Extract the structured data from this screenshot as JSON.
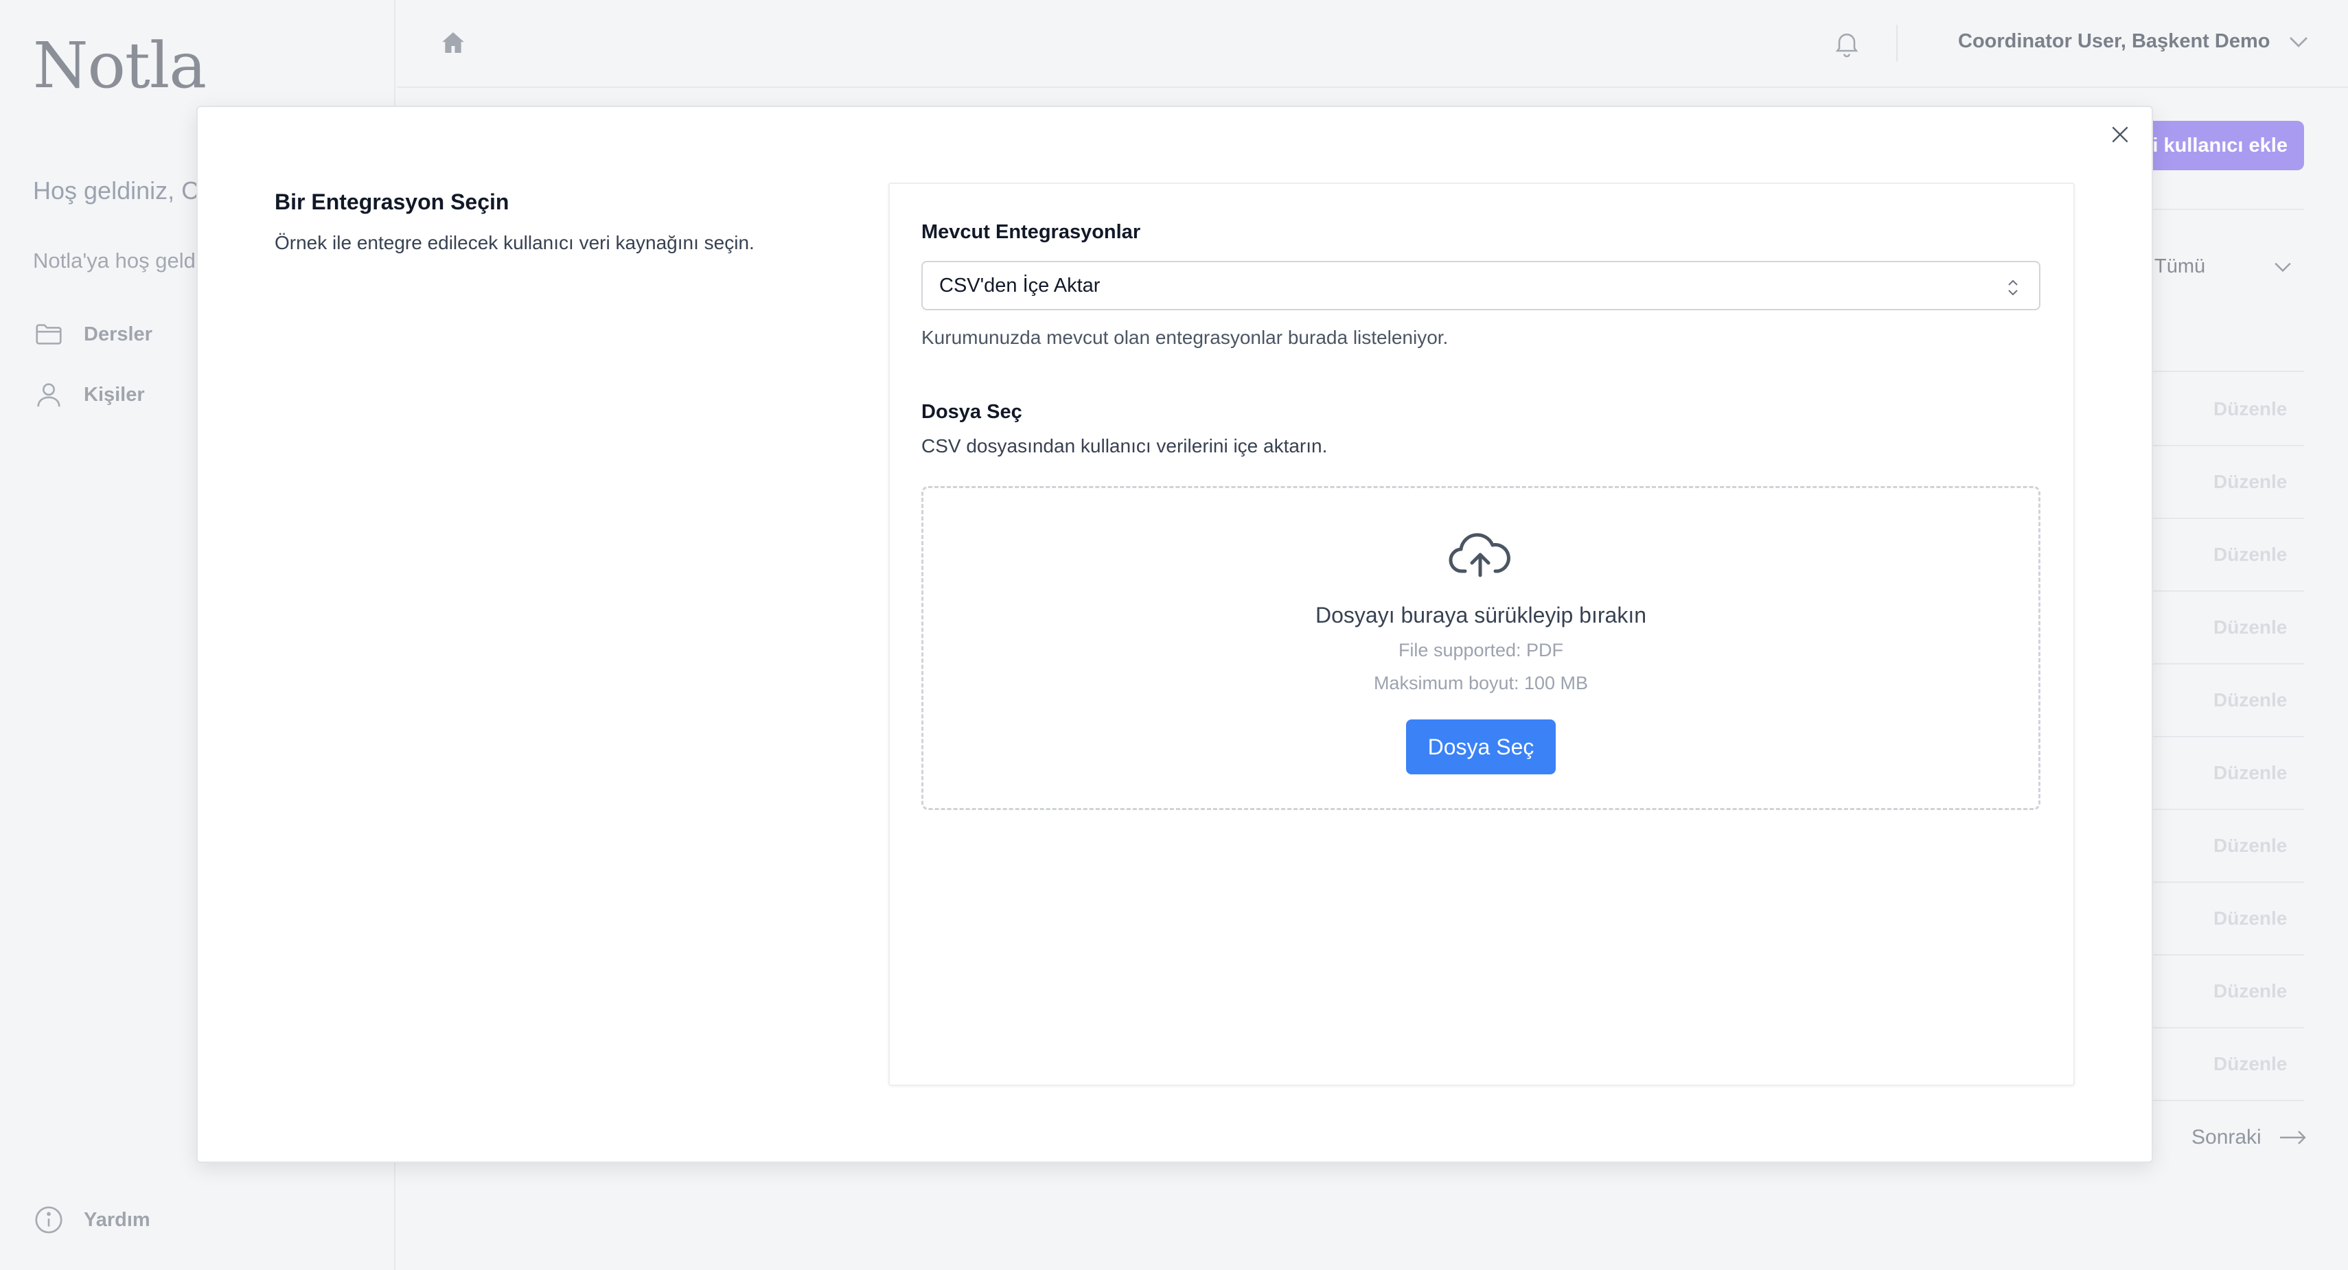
{
  "app": {
    "logo": "Notla"
  },
  "sidebar": {
    "welcome": "Hoş geldiniz, Coordinator User!",
    "welcome_sub": "Notla'ya hoş geldiniz",
    "items": [
      {
        "label": "Dersler",
        "icon": "folder-icon"
      },
      {
        "label": "Kişiler",
        "icon": "person-icon"
      }
    ],
    "help_label": "Yardım"
  },
  "header": {
    "user_menu": "Coordinator User, Başkent Demo"
  },
  "background": {
    "add_user_label": "Yeni kullanıcı ekle",
    "filter_value": "Tümü",
    "row_action": "Düzenle",
    "next_label": "Sonraki"
  },
  "modal": {
    "step_title": "Bir Entegrasyon Seçin",
    "step_description": "Örnek ile entegre edilecek kullanıcı veri kaynağını seçin.",
    "integrations_label": "Mevcut Entegrasyonlar",
    "integration_selected": "CSV'den İçe Aktar",
    "integrations_help": "Kurumunuzda mevcut olan entegrasyonlar burada listeleniyor.",
    "file_label": "Dosya Seç",
    "file_description": "CSV dosyasından kullanıcı verilerini içe aktarın.",
    "dropzone": {
      "title": "Dosyayı buraya sürükleyip bırakın",
      "supported": "File supported: PDF",
      "max_size": "Maksimum boyut: 100 MB",
      "button_label": "Dosya Seç"
    }
  },
  "colors": {
    "primary_button": "#3b82f6",
    "add_user_button": "#a99bf0"
  }
}
